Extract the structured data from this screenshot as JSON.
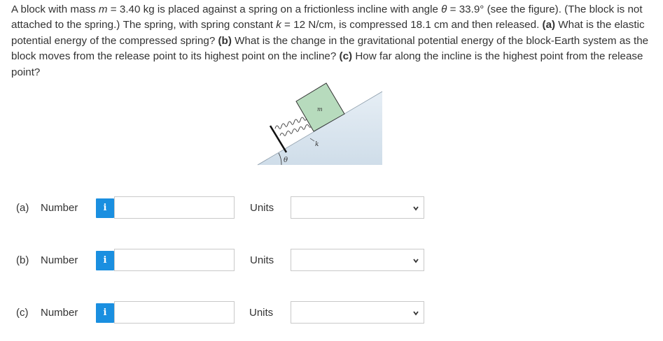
{
  "question": {
    "s1": "A block with mass ",
    "s2": "m",
    "s3": " = 3.40 kg is placed against a spring on a frictionless incline with angle ",
    "s4": "θ",
    "s5": " = 33.9° (see the figure). (The block is not attached to the spring.) The spring, with spring constant ",
    "s6": "k",
    "s7": " = 12 N/cm, is compressed 18.1 cm and then released. ",
    "s8": "(a)",
    "s9": " What is the elastic potential energy of the compressed spring? ",
    "s10": "(b)",
    "s11": " What is the change in the gravitational potential energy of the block-Earth system as the block moves from the release point to its highest point on the incline? ",
    "s12": "(c)",
    "s13": " How far along the incline is the highest point from the release point?"
  },
  "figure": {
    "block_label": "m",
    "spring_label": "k",
    "angle_label": "θ",
    "incline_color": "#dbe7f0",
    "block_color": "#b7dbbd"
  },
  "answers": [
    {
      "part": "(a)",
      "number_label": "Number",
      "info_icon": "i",
      "value": "",
      "units_label": "Units",
      "units_selected": ""
    },
    {
      "part": "(b)",
      "number_label": "Number",
      "info_icon": "i",
      "value": "",
      "units_label": "Units",
      "units_selected": ""
    },
    {
      "part": "(c)",
      "number_label": "Number",
      "info_icon": "i",
      "value": "",
      "units_label": "Units",
      "units_selected": ""
    }
  ],
  "colors": {
    "info_button": "#1a8fe0",
    "text": "#333333",
    "input_border": "#c9c9c9"
  }
}
